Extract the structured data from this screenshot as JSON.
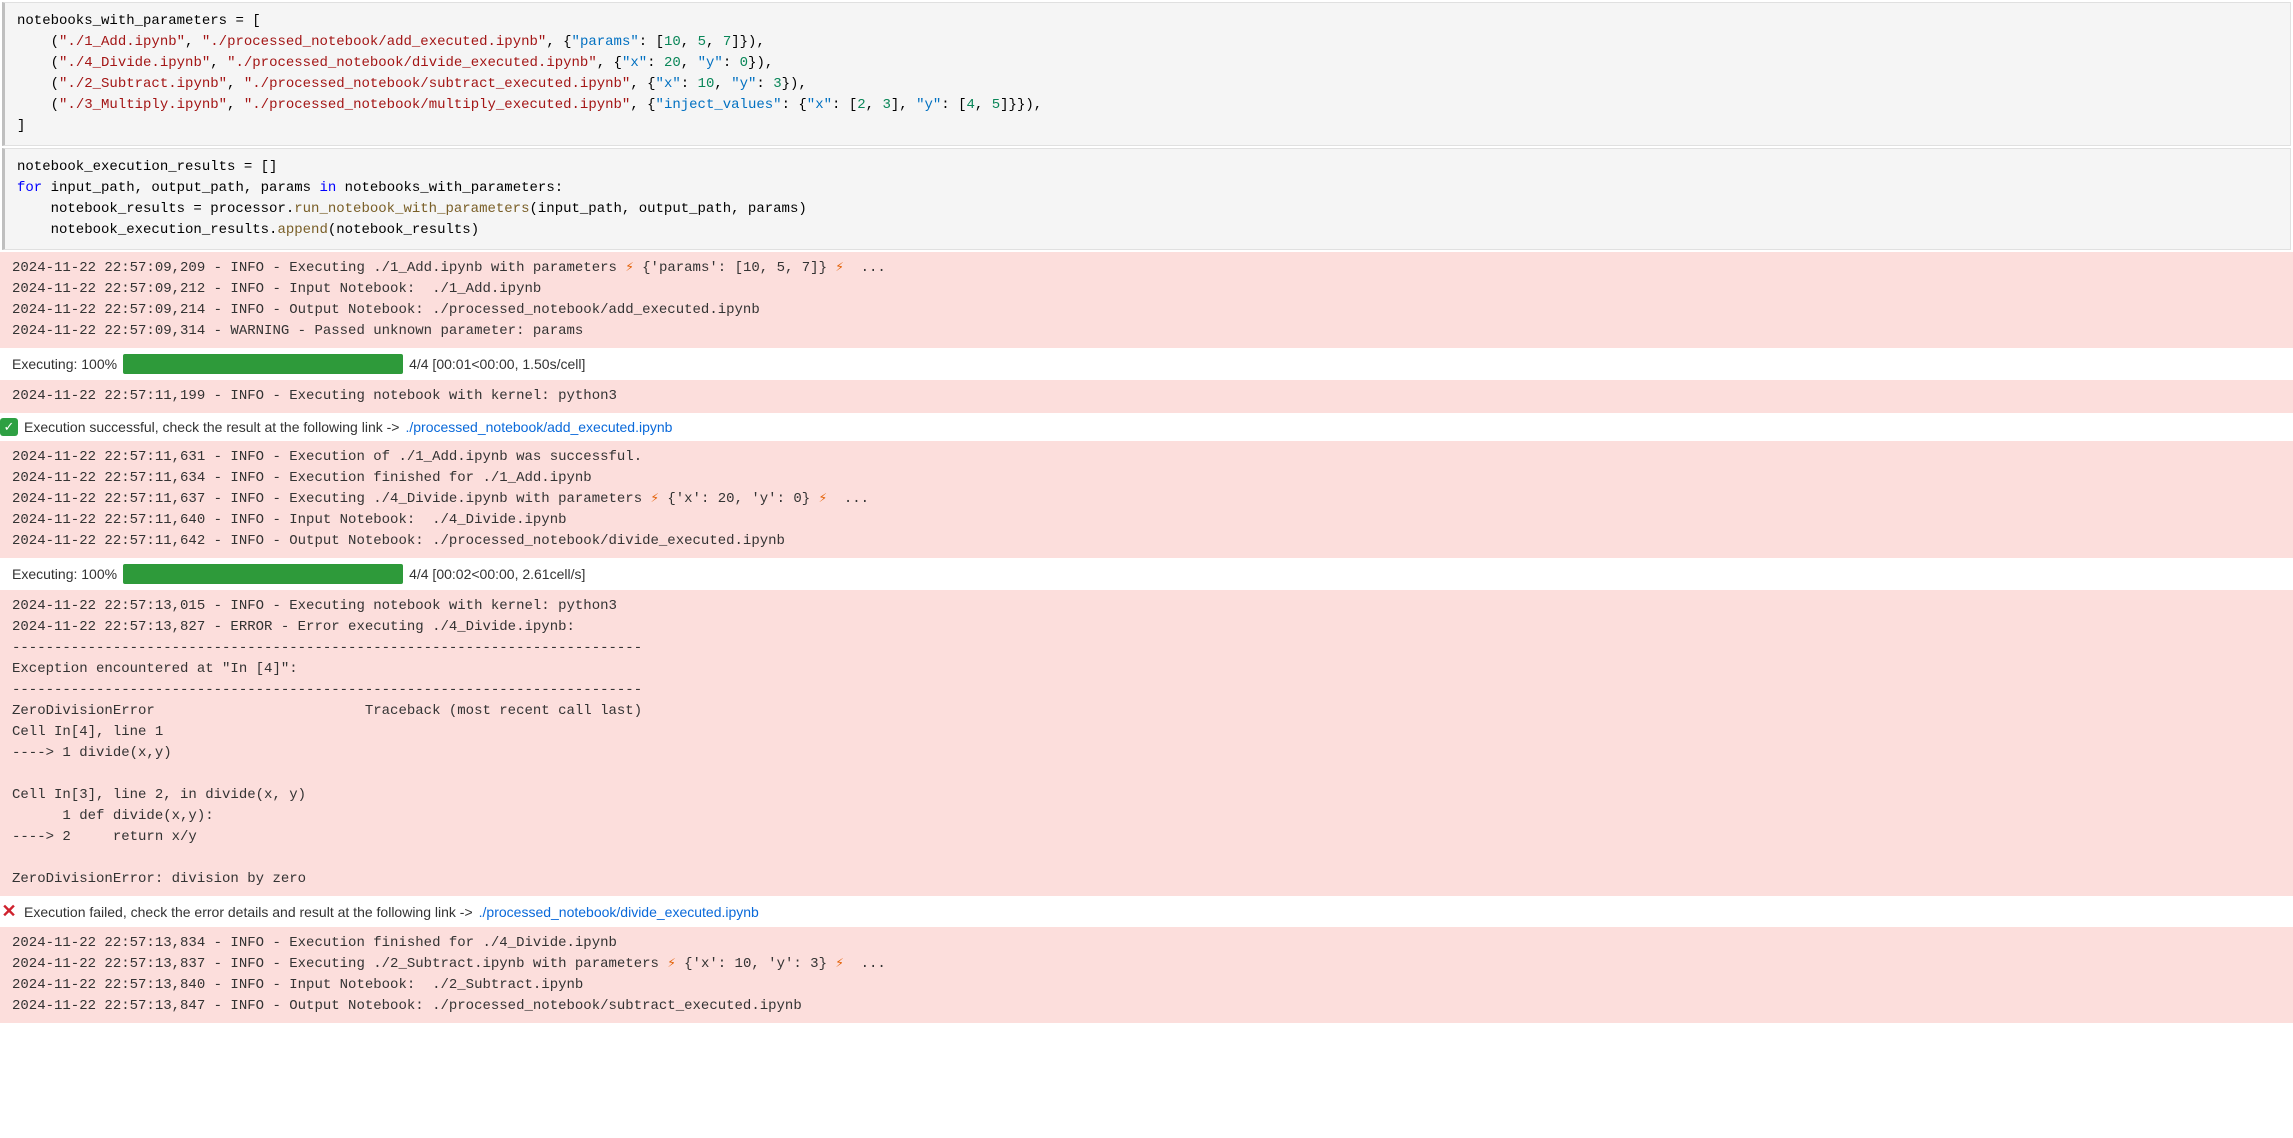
{
  "code_block_1": {
    "tokens": [
      [
        [
          "notebooks_with_parameters ",
          "s-black"
        ],
        [
          "= [",
          "s-black"
        ]
      ],
      [
        [
          "    (",
          "s-black"
        ],
        [
          "\"./1_Add.ipynb\"",
          "s-red"
        ],
        [
          ", ",
          "s-black"
        ],
        [
          "\"./processed_notebook/add_executed.ipynb\"",
          "s-red"
        ],
        [
          ", {",
          "s-black"
        ],
        [
          "\"params\"",
          "s-teal"
        ],
        [
          ": [",
          "s-black"
        ],
        [
          "10",
          "s-green"
        ],
        [
          ", ",
          "s-black"
        ],
        [
          "5",
          "s-green"
        ],
        [
          ", ",
          "s-black"
        ],
        [
          "7",
          "s-green"
        ],
        [
          "]}),",
          "s-black"
        ]
      ],
      [
        [
          "    (",
          "s-black"
        ],
        [
          "\"./4_Divide.ipynb\"",
          "s-red"
        ],
        [
          ", ",
          "s-black"
        ],
        [
          "\"./processed_notebook/divide_executed.ipynb\"",
          "s-red"
        ],
        [
          ", {",
          "s-black"
        ],
        [
          "\"x\"",
          "s-teal"
        ],
        [
          ": ",
          "s-black"
        ],
        [
          "20",
          "s-green"
        ],
        [
          ", ",
          "s-black"
        ],
        [
          "\"y\"",
          "s-teal"
        ],
        [
          ": ",
          "s-black"
        ],
        [
          "0",
          "s-green"
        ],
        [
          "}),",
          "s-black"
        ]
      ],
      [
        [
          "    (",
          "s-black"
        ],
        [
          "\"./2_Subtract.ipynb\"",
          "s-red"
        ],
        [
          ", ",
          "s-black"
        ],
        [
          "\"./processed_notebook/subtract_executed.ipynb\"",
          "s-red"
        ],
        [
          ", {",
          "s-black"
        ],
        [
          "\"x\"",
          "s-teal"
        ],
        [
          ": ",
          "s-black"
        ],
        [
          "10",
          "s-green"
        ],
        [
          ", ",
          "s-black"
        ],
        [
          "\"y\"",
          "s-teal"
        ],
        [
          ": ",
          "s-black"
        ],
        [
          "3",
          "s-green"
        ],
        [
          "}),",
          "s-black"
        ]
      ],
      [
        [
          "    (",
          "s-black"
        ],
        [
          "\"./3_Multiply.ipynb\"",
          "s-red"
        ],
        [
          ", ",
          "s-black"
        ],
        [
          "\"./processed_notebook/multiply_executed.ipynb\"",
          "s-red"
        ],
        [
          ", {",
          "s-black"
        ],
        [
          "\"inject_values\"",
          "s-teal"
        ],
        [
          ": {",
          "s-black"
        ],
        [
          "\"x\"",
          "s-teal"
        ],
        [
          ": [",
          "s-black"
        ],
        [
          "2",
          "s-green"
        ],
        [
          ", ",
          "s-black"
        ],
        [
          "3",
          "s-green"
        ],
        [
          "], ",
          "s-black"
        ],
        [
          "\"y\"",
          "s-teal"
        ],
        [
          ": [",
          "s-black"
        ],
        [
          "4",
          "s-green"
        ],
        [
          ", ",
          "s-black"
        ],
        [
          "5",
          "s-green"
        ],
        [
          "]}}),",
          "s-black"
        ]
      ],
      [
        [
          "]",
          "s-black"
        ]
      ]
    ]
  },
  "code_block_2": {
    "tokens": [
      [
        [
          "notebook_execution_results = []",
          "s-black"
        ]
      ],
      [
        [
          "for",
          "s-blue"
        ],
        [
          " input_path, output_path, params ",
          "s-black"
        ],
        [
          "in",
          "s-blue"
        ],
        [
          " notebooks_with_parameters:",
          "s-black"
        ]
      ],
      [
        [
          "    notebook_results = processor.",
          "s-black"
        ],
        [
          "run_notebook_with_parameters",
          "s-olive"
        ],
        [
          "(input_path, output_path, params)",
          "s-black"
        ]
      ],
      [
        [
          "    notebook_execution_results.",
          "s-black"
        ],
        [
          "append",
          "s-olive"
        ],
        [
          "(notebook_results)",
          "s-black"
        ]
      ]
    ]
  },
  "log1": {
    "l1_pre": "2024-11-22 22:57:09,209 - INFO - Executing ./1_Add.ipynb with parameters ",
    "l1_params": " {'params': [10, 5, 7]} ",
    "l1_post": "  ...",
    "l2": "2024-11-22 22:57:09,212 - INFO - Input Notebook:  ./1_Add.ipynb",
    "l3": "2024-11-22 22:57:09,214 - INFO - Output Notebook: ./processed_notebook/add_executed.ipynb",
    "l4": "2024-11-22 22:57:09,314 - WARNING - Passed unknown parameter: params"
  },
  "progress1": {
    "label": "Executing: 100%",
    "stats": "4/4 [00:01<00:00,   1.50s/cell]"
  },
  "log2": {
    "l1": "2024-11-22 22:57:11,199 - INFO - Executing notebook with kernel: python3"
  },
  "status_success": {
    "text": "Execution successful, check the result at the following link -> ",
    "link": "./processed_notebook/add_executed.ipynb"
  },
  "log3": {
    "l1": "2024-11-22 22:57:11,631 - INFO - Execution of ./1_Add.ipynb was successful.",
    "l2": "2024-11-22 22:57:11,634 - INFO - Execution finished for ./1_Add.ipynb",
    "l3_pre": "2024-11-22 22:57:11,637 - INFO - Executing ./4_Divide.ipynb with parameters ",
    "l3_params": " {'x': 20, 'y': 0} ",
    "l3_post": "  ...",
    "l4": "2024-11-22 22:57:11,640 - INFO - Input Notebook:  ./4_Divide.ipynb",
    "l5": "2024-11-22 22:57:11,642 - INFO - Output Notebook: ./processed_notebook/divide_executed.ipynb"
  },
  "progress2": {
    "label": "Executing: 100%",
    "stats": "4/4 [00:02<00:00,   2.61cell/s]"
  },
  "log4": {
    "l1": "2024-11-22 22:57:13,015 - INFO - Executing notebook with kernel: python3",
    "l2": "2024-11-22 22:57:13,827 - ERROR - Error executing ./4_Divide.ipynb:",
    "dash": "---------------------------------------------------------------------------",
    "exc": "Exception encountered at \"In [4]\":",
    "tb1": "ZeroDivisionError                         Traceback (most recent call last)",
    "tb2": "Cell In[4], line 1",
    "tb3": "----> 1 divide(x,y)",
    "tb4": "Cell In[3], line 2, in divide(x, y)",
    "tb5": "      1 def divide(x,y):",
    "tb6": "----> 2     return x/y",
    "tb7": "ZeroDivisionError: division by zero"
  },
  "status_fail": {
    "text": "Execution failed, check the error details and result at the following link -> ",
    "link": "./processed_notebook/divide_executed.ipynb"
  },
  "log5": {
    "l1": "2024-11-22 22:57:13,834 - INFO - Execution finished for ./4_Divide.ipynb",
    "l2_pre": "2024-11-22 22:57:13,837 - INFO - Executing ./2_Subtract.ipynb with parameters ",
    "l2_params": " {'x': 10, 'y': 3} ",
    "l2_post": "  ...",
    "l3": "2024-11-22 22:57:13,840 - INFO - Input Notebook:  ./2_Subtract.ipynb",
    "l4": "2024-11-22 22:57:13,847 - INFO - Output Notebook: ./processed_notebook/subtract_executed.ipynb"
  },
  "icons": {
    "lightning": "⚡",
    "check": "✓",
    "cross": "✕"
  }
}
